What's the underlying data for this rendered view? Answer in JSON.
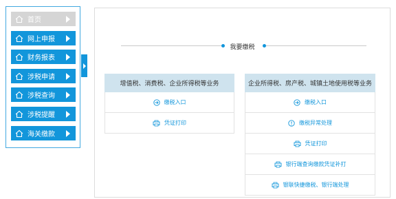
{
  "sidebar": {
    "items": [
      {
        "label": "首页",
        "active": true
      },
      {
        "label": "网上申报"
      },
      {
        "label": "财务报表"
      },
      {
        "label": "涉税申请"
      },
      {
        "label": "涉税查询"
      },
      {
        "label": "涉税提醒"
      },
      {
        "label": "海关缴款"
      }
    ]
  },
  "main": {
    "title": "我要缴税",
    "left": {
      "header": "增值税、消费税、企业所得税等业务",
      "items": [
        {
          "label": "缴税入口",
          "icon": "enter-icon"
        },
        {
          "label": "凭证打印",
          "icon": "print-icon"
        }
      ]
    },
    "right": {
      "header": "企业所得税、房产税、城镇土地使用税等业务",
      "items": [
        {
          "label": "缴税入口",
          "icon": "enter-icon"
        },
        {
          "label": "缴税异常处理",
          "icon": "alert-icon"
        },
        {
          "label": "凭证打印",
          "icon": "print-icon"
        },
        {
          "label": "银行端查询缴款凭证补打",
          "icon": "print-icon"
        },
        {
          "label": "银联快捷缴税、银行端处理",
          "icon": "print-icon"
        }
      ]
    }
  },
  "colors": {
    "accent": "#1296db",
    "home_bg": "#d5d5d5",
    "header_bg": "#cfe3ee"
  }
}
